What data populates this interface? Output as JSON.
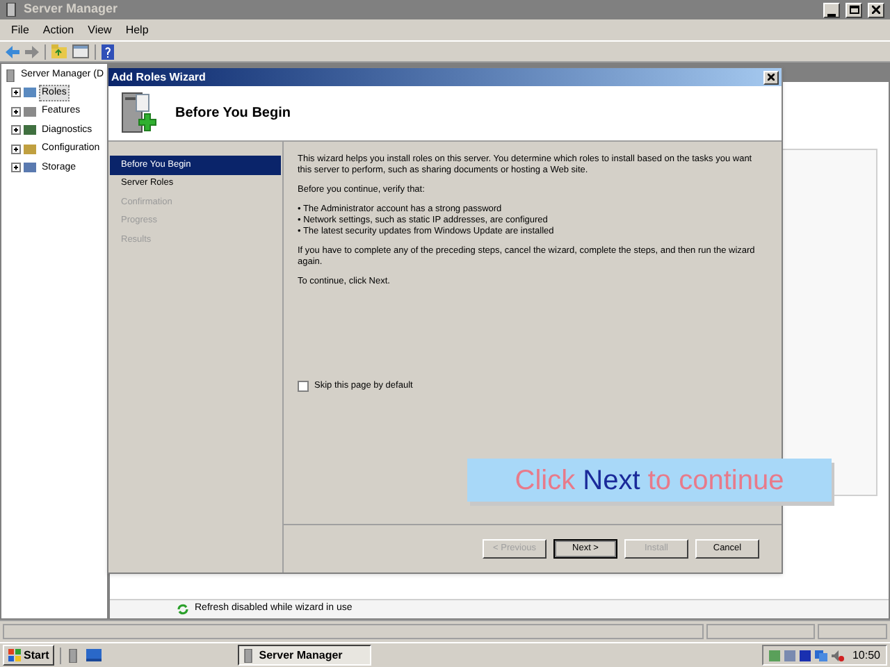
{
  "window": {
    "title": "Server Manager"
  },
  "menu": [
    "File",
    "Action",
    "View",
    "Help"
  ],
  "tree": {
    "root": "Server Manager (D",
    "children": [
      {
        "label": "Roles",
        "selected": true
      },
      {
        "label": "Features",
        "selected": false
      },
      {
        "label": "Diagnostics",
        "selected": false
      },
      {
        "label": "Configuration",
        "selected": false
      },
      {
        "label": "Storage",
        "selected": false
      }
    ]
  },
  "wizard": {
    "title": "Add Roles Wizard",
    "heading": "Before You Begin",
    "steps": [
      {
        "label": "Before You Begin",
        "selected": true,
        "disabled": false
      },
      {
        "label": "Server Roles",
        "selected": false,
        "disabled": false
      },
      {
        "label": "Confirmation",
        "selected": false,
        "disabled": true
      },
      {
        "label": "Progress",
        "selected": false,
        "disabled": true
      },
      {
        "label": "Results",
        "selected": false,
        "disabled": true
      }
    ],
    "intro": "This wizard helps you install roles on this server. You determine which roles to install based on the tasks you want this server to perform, such as sharing documents or hosting a Web site.",
    "verify": "Before you continue, verify that:",
    "bullets": [
      "• The Administrator account has a strong password",
      "• Network settings, such as static IP addresses, are configured",
      "• The latest security updates from Windows Update are installed"
    ],
    "advice": "If you have to complete any of the preceding steps, cancel the wizard, complete the steps, and then run the wizard again.",
    "continue": "To continue, click Next.",
    "skip": {
      "label": "Skip this page by default",
      "checked": false
    },
    "buttons": [
      {
        "label": "< Previous",
        "disabled": true,
        "default": false
      },
      {
        "label": "Next >",
        "disabled": false,
        "default": true
      },
      {
        "label": "Install",
        "disabled": true,
        "default": false
      },
      {
        "label": "Cancel",
        "disabled": false,
        "default": false
      }
    ]
  },
  "status_message": "Refresh disabled while wizard in use",
  "caption": [
    {
      "text": "Click",
      "kind": "plain"
    },
    {
      "text": "Next",
      "kind": "highlight"
    },
    {
      "text": "to continue",
      "kind": "plain"
    }
  ],
  "taskbar": {
    "start": "Start",
    "task": "Server Manager",
    "clock": "10:50"
  }
}
